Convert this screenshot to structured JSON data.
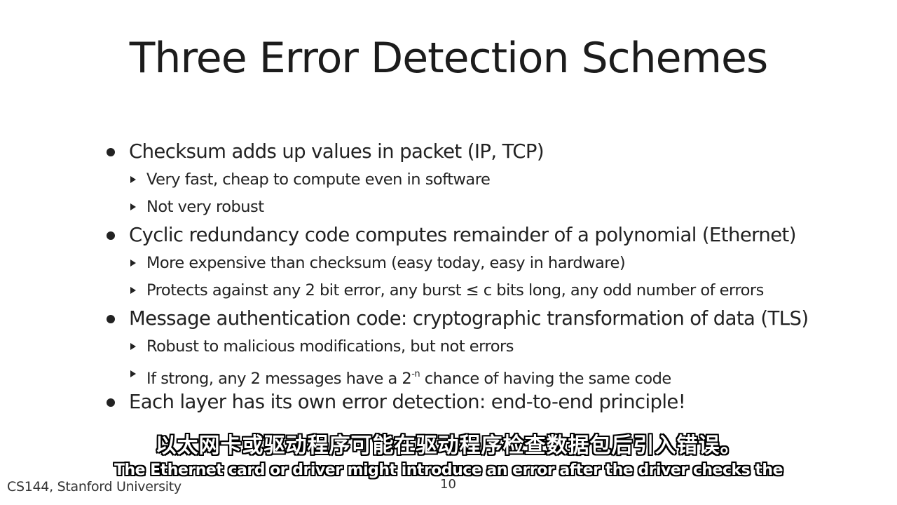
{
  "slide": {
    "title": "Three Error Detection Schemes",
    "bullets": [
      {
        "text": "Checksum adds up values in packet (IP, TCP)",
        "subs": [
          "Very fast, cheap to compute even in software",
          "Not very robust"
        ]
      },
      {
        "text": "Cyclic redundancy code computes remainder of a polynomial (Ethernet)",
        "subs": [
          "More expensive than checksum (easy today, easy in hardware)",
          "Protects against any 2 bit error, any burst ≤ c bits long, any odd number of errors"
        ]
      },
      {
        "text": "Message authentication code: cryptographic transformation of data (TLS)",
        "subs": [
          "Robust to malicious modifications, but not errors",
          {
            "before": "If strong, any 2 messages have a 2",
            "sup": "-n",
            "after": " chance of having the same code"
          }
        ]
      },
      {
        "text": "Each layer has its own error detection: end-to-end principle!",
        "subs": []
      }
    ],
    "footer": "CS144, Stanford University",
    "page_number": "10"
  },
  "subtitles": {
    "chinese": "以太网卡或驱动程序可能在驱动程序检查数据包后引入错误。",
    "english": "The Ethernet card or driver might introduce an error after the driver checks the"
  }
}
